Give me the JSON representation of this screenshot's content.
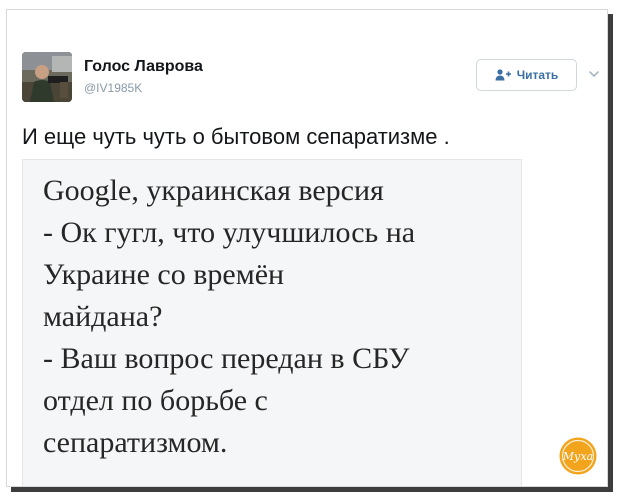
{
  "tweet": {
    "author_name": "Голос Лаврова",
    "author_handle": "@IV1985K",
    "follow_label": "Читать",
    "text": "И еще чуть чуть о бытовом сепаратизме .",
    "image_text": "Google, украинская версия\n- Ок гугл, что улучшилось на\nУкраине со времён\nмайдана?\n- Ваш вопрос передан в СБУ\nотдел по борьбе с\nсепаратизмом."
  },
  "watermark": {
    "label": "Муха"
  },
  "colors": {
    "follow_text": "#3b6fa3",
    "watermark": "#f2a41c",
    "shadow": "#3d3d3d"
  },
  "icons": {
    "follow": "add-user-icon",
    "menu": "chevron-down-icon"
  }
}
